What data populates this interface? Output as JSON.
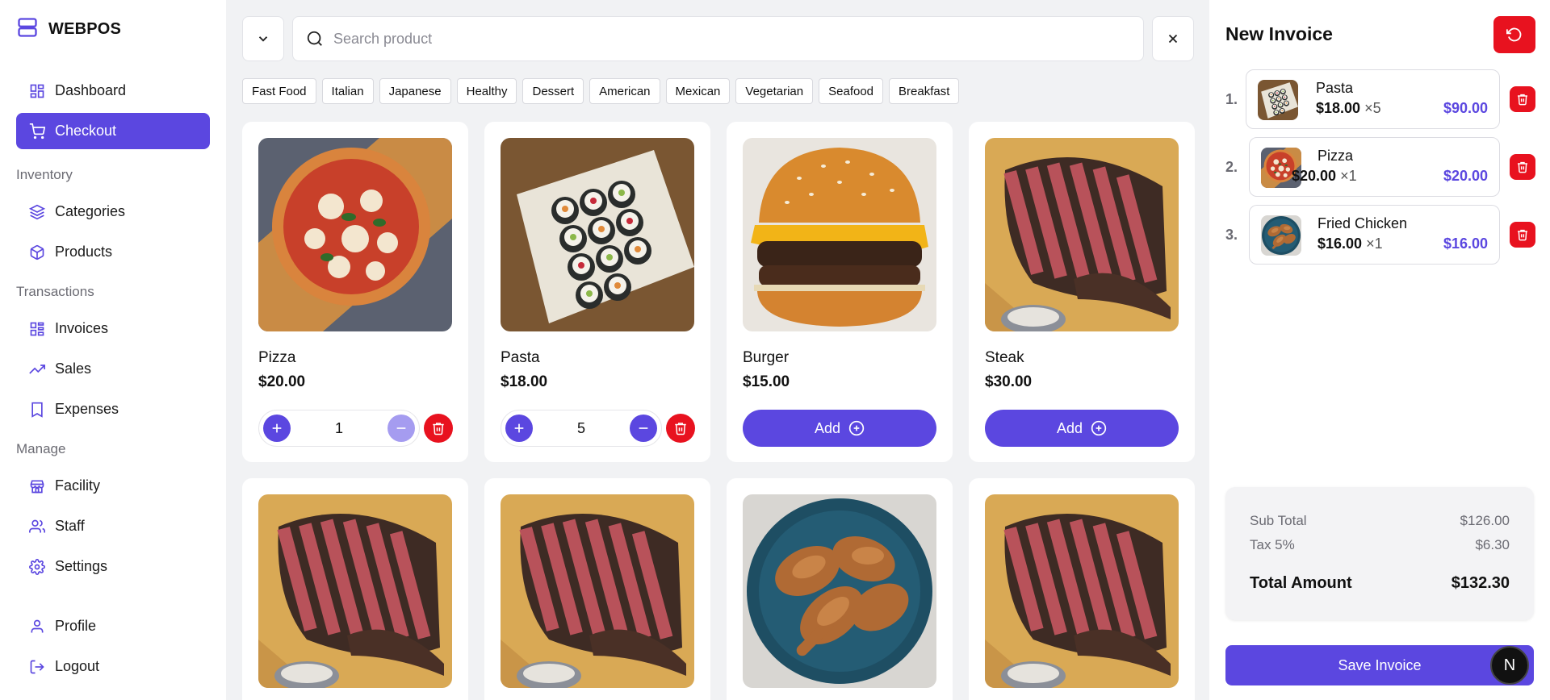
{
  "brand": {
    "name": "WEBPOS",
    "icon": "server-icon"
  },
  "sidebar": {
    "items": [
      {
        "label": "Dashboard",
        "icon": "dashboard-icon",
        "active": false
      },
      {
        "label": "Checkout",
        "icon": "cart-icon",
        "active": true
      }
    ],
    "section_inventory": "Inventory",
    "inventory": [
      {
        "label": "Categories",
        "icon": "layers-icon"
      },
      {
        "label": "Products",
        "icon": "box-icon"
      }
    ],
    "section_transactions": "Transactions",
    "transactions": [
      {
        "label": "Invoices",
        "icon": "invoice-icon"
      },
      {
        "label": "Sales",
        "icon": "trend-icon"
      },
      {
        "label": "Expenses",
        "icon": "receipt-icon"
      }
    ],
    "section_manage": "Manage",
    "manage": [
      {
        "label": "Facility",
        "icon": "store-icon"
      },
      {
        "label": "Staff",
        "icon": "users-icon"
      },
      {
        "label": "Settings",
        "icon": "gear-icon"
      }
    ],
    "bottom": [
      {
        "label": "Profile",
        "icon": "user-icon"
      },
      {
        "label": "Logout",
        "icon": "logout-icon"
      }
    ]
  },
  "search": {
    "placeholder": "Search product",
    "value": ""
  },
  "categories": [
    "Fast Food",
    "Italian",
    "Japanese",
    "Healthy",
    "Dessert",
    "American",
    "Mexican",
    "Vegetarian",
    "Seafood",
    "Breakfast"
  ],
  "products": [
    {
      "name": "Pizza",
      "price": "$20.00",
      "qty": "1",
      "image": "pizza"
    },
    {
      "name": "Pasta",
      "price": "$18.00",
      "qty": "5",
      "image": "sushi"
    },
    {
      "name": "Burger",
      "price": "$15.00",
      "add_label": "Add",
      "image": "burger"
    },
    {
      "name": "Steak",
      "price": "$30.00",
      "add_label": "Add",
      "image": "steak"
    },
    {
      "image": "steak"
    },
    {
      "image": "steak"
    },
    {
      "image": "chicken"
    },
    {
      "image": "steak"
    }
  ],
  "invoice": {
    "title": "New Invoice",
    "lines": [
      {
        "no": "1.",
        "name": "Pasta",
        "price": "$18.00",
        "qty": "×5",
        "total": "$90.00",
        "image": "sushi"
      },
      {
        "no": "2.",
        "name": "Pizza",
        "price": "$20.00",
        "qty": "×1",
        "total": "$20.00",
        "image": "pizza"
      },
      {
        "no": "3.",
        "name": "Fried Chicken",
        "price": "$16.00",
        "qty": "×1",
        "total": "$16.00",
        "image": "chicken"
      }
    ],
    "subtotal_label": "Sub Total",
    "subtotal": "$126.00",
    "tax_label": "Tax 5%",
    "tax": "$6.30",
    "total_label": "Total Amount",
    "total": "$132.30",
    "save_label": "Save Invoice",
    "badge": "N"
  },
  "colors": {
    "accent": "#5b47e0",
    "danger": "#e8121f"
  }
}
